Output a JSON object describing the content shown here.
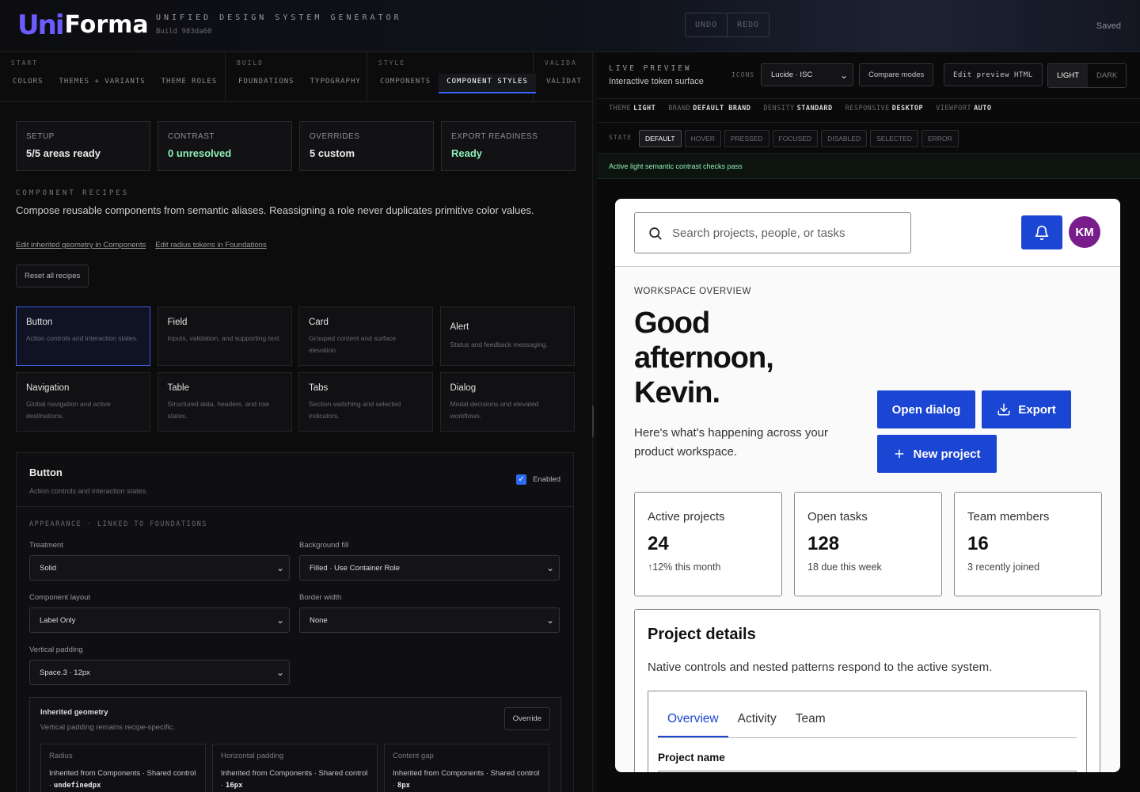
{
  "header": {
    "logo_uni": "Uni",
    "logo_forma": "Forma",
    "subtitle": "UNIFIED DESIGN SYSTEM GENERATOR",
    "build": "Build 983da60",
    "undo_label": "UNDO",
    "redo_label": "REDO",
    "status": "Saved"
  },
  "nav": {
    "groups": [
      {
        "label": "START",
        "items": [
          "COLORS",
          "THEMES + VARIANTS",
          "THEME ROLES"
        ]
      },
      {
        "label": "BUILD",
        "items": [
          "FOUNDATIONS",
          "TYPOGRAPHY"
        ]
      },
      {
        "label": "STYLE",
        "items": [
          "COMPONENTS",
          "COMPONENT STYLES"
        ]
      },
      {
        "label": "VALIDA",
        "items": [
          "VALIDAT"
        ]
      }
    ],
    "active_item": "COMPONENT STYLES"
  },
  "summary_cards": [
    {
      "label": "SETUP",
      "value": "5/5 areas ready"
    },
    {
      "label": "CONTRAST",
      "value": "0 unresolved"
    },
    {
      "label": "OVERRIDES",
      "value": "5 custom"
    },
    {
      "label": "EXPORT READINESS",
      "value": "Ready"
    }
  ],
  "recipes": {
    "label": "COMPONENT RECIPES",
    "description": "Compose reusable components from semantic aliases. Reassigning a role never duplicates primitive color values.",
    "link_geometry": "Edit inherited geometry in Components",
    "link_radius": "Edit radius tokens in Foundations",
    "reset_label": "Reset all recipes",
    "items": [
      {
        "title": "Button",
        "desc": "Action controls and interaction states."
      },
      {
        "title": "Field",
        "desc": "Inputs, validation, and supporting text."
      },
      {
        "title": "Card",
        "desc": "Grouped content and surface elevation."
      },
      {
        "title": "Alert",
        "desc": "Status and feedback messaging."
      },
      {
        "title": "Navigation",
        "desc": "Global navigation and active destinations."
      },
      {
        "title": "Table",
        "desc": "Structured data, headers, and row states."
      },
      {
        "title": "Tabs",
        "desc": "Section switching and selected indicators."
      },
      {
        "title": "Dialog",
        "desc": "Modal decisions and elevated workflows."
      }
    ]
  },
  "button_panel": {
    "title": "Button",
    "desc": "Action controls and interaction states.",
    "enabled_label": "Enabled",
    "appearance_label": "APPEARANCE · LINKED TO FOUNDATIONS",
    "treatment_label": "Treatment",
    "treatment_value": "Solid",
    "background_label": "Background fill",
    "background_value": "Filled · Use Container Role",
    "layout_label": "Component layout",
    "layout_value": "Label Only",
    "border_label": "Border width",
    "border_value": "None",
    "vpad_label": "Vertical padding",
    "vpad_value": "Space.3 · 12px",
    "inherited": {
      "title": "Inherited geometry",
      "desc": "Vertical padding remains recipe-specific.",
      "override_label": "Override",
      "cells": [
        {
          "label": "Radius",
          "text": "Inherited from Components · Shared control · ",
          "code": "undefinedpx"
        },
        {
          "label": "Horizontal padding",
          "text": "Inherited from Components · Shared control · ",
          "code": "16px"
        },
        {
          "label": "Content gap",
          "text": "Inherited from Components · Shared control · ",
          "code": "8px"
        }
      ]
    }
  },
  "preview_panel": {
    "label": "LIVE PREVIEW",
    "subtitle": "Interactive token surface",
    "icons_label": "ICONS",
    "icons_value": "Lucide · ISC",
    "compare_label": "Compare modes",
    "edit_html_label": "Edit preview HTML",
    "mode_light": "LIGHT",
    "mode_dark": "DARK",
    "tokens": [
      {
        "key": "THEME",
        "value": "LIGHT"
      },
      {
        "key": "BRAND",
        "value": "DEFAULT BRAND"
      },
      {
        "key": "DENSITY",
        "value": "STANDARD"
      },
      {
        "key": "RESPONSIVE",
        "value": "DESKTOP"
      },
      {
        "key": "VIEWPORT",
        "value": "AUTO"
      }
    ],
    "state_label": "STATE",
    "states": [
      "DEFAULT",
      "HOVER",
      "PRESSED",
      "FOCUSED",
      "DISABLED",
      "SELECTED",
      "ERROR"
    ],
    "contrast_message": "Active light semantic contrast checks pass"
  },
  "preview": {
    "search_placeholder": "Search projects, people, or tasks",
    "avatar_initials": "KM",
    "eyebrow": "WORKSPACE OVERVIEW",
    "title": "Good afternoon, Kevin.",
    "description": "Here's what's happening across your product workspace.",
    "open_dialog": "Open dialog",
    "export": "Export",
    "new_project": "New project",
    "stats": [
      {
        "label": "Active projects",
        "value": "24",
        "detail": "12% this month"
      },
      {
        "label": "Open tasks",
        "value": "128",
        "detail": "18 due this week"
      },
      {
        "label": "Team members",
        "value": "16",
        "detail": "3 recently joined"
      }
    ],
    "details_title": "Project details",
    "details_desc": "Native controls and nested patterns respond to the active system.",
    "tabs": [
      "Overview",
      "Activity",
      "Team"
    ],
    "project_name_label": "Project name"
  },
  "colors": {
    "accent": "#1b46d3",
    "logo_accent": "#6b5cff",
    "success": "#8ef0b8",
    "avatar": "#7a1d8c"
  }
}
